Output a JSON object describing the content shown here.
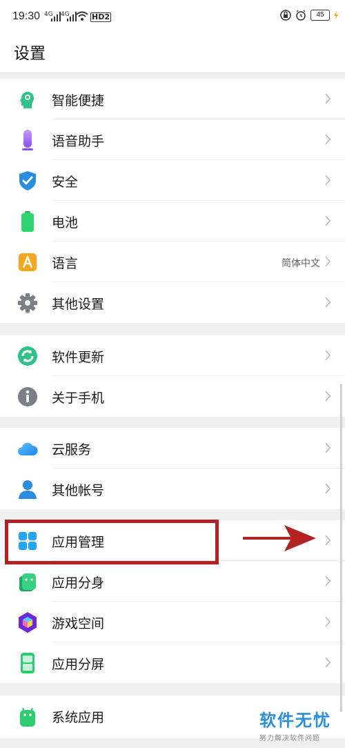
{
  "status_bar": {
    "time": "19:30",
    "signal_1": "4G",
    "signal_2": "4G",
    "hd_badge": "HD2",
    "battery": "45"
  },
  "header": {
    "title": "设置"
  },
  "sections": [
    {
      "items": [
        {
          "label": "智能便捷",
          "icon": "smart-assist-icon"
        },
        {
          "label": "语音助手",
          "icon": "microphone-icon"
        },
        {
          "label": "安全",
          "icon": "shield-check-icon"
        },
        {
          "label": "电池",
          "icon": "battery-icon"
        },
        {
          "label": "语言",
          "icon": "language-icon",
          "value": "简体中文"
        },
        {
          "label": "其他设置",
          "icon": "gear-icon"
        }
      ]
    },
    {
      "items": [
        {
          "label": "软件更新",
          "icon": "update-icon"
        },
        {
          "label": "关于手机",
          "icon": "info-icon"
        }
      ]
    },
    {
      "items": [
        {
          "label": "云服务",
          "icon": "cloud-icon"
        },
        {
          "label": "其他帐号",
          "icon": "person-icon"
        }
      ]
    },
    {
      "items": [
        {
          "label": "应用管理",
          "icon": "app-grid-icon"
        },
        {
          "label": "应用分身",
          "icon": "android-clone-icon"
        },
        {
          "label": "游戏空间",
          "icon": "game-cube-icon"
        },
        {
          "label": "应用分屏",
          "icon": "split-screen-icon"
        }
      ]
    },
    {
      "items": [
        {
          "label": "系统应用",
          "icon": "android-icon"
        }
      ]
    }
  ],
  "watermark": {
    "main": "软件无忧",
    "sub": "努力解决软件问题"
  },
  "colors": {
    "highlight": "#b32222",
    "accent": "#2a8de0"
  }
}
